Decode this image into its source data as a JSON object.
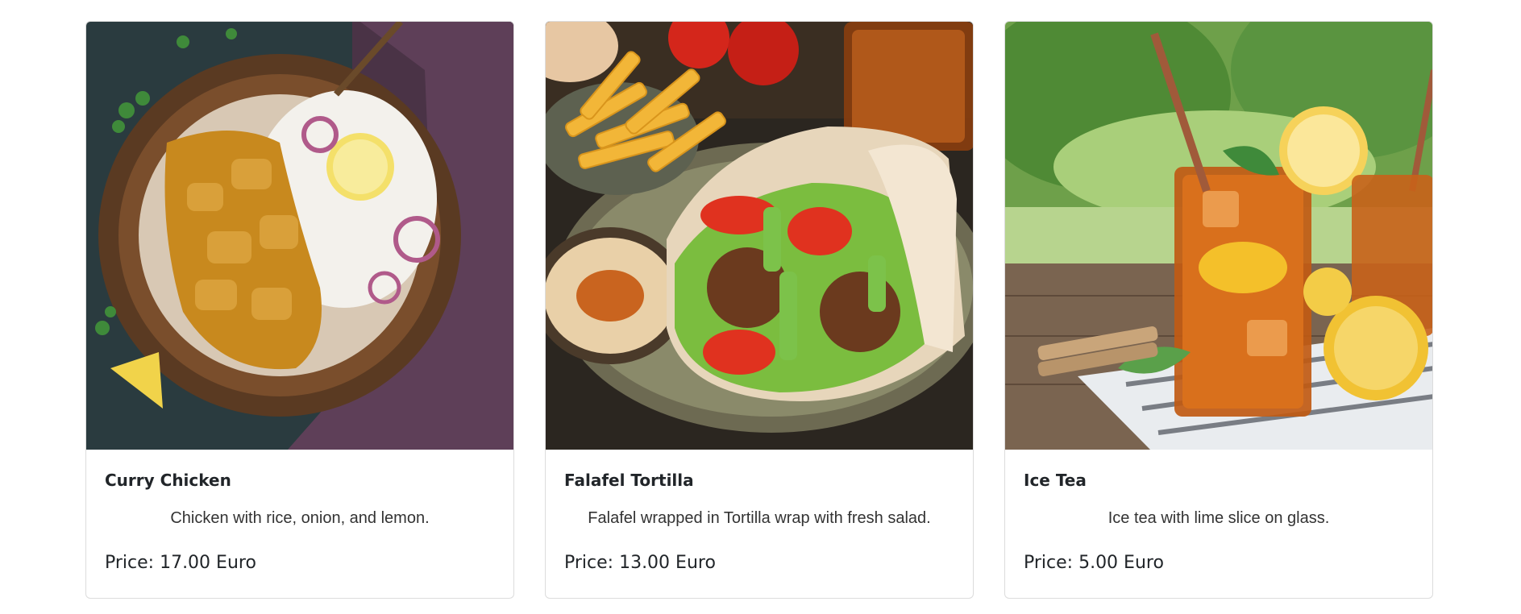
{
  "menu": {
    "items": [
      {
        "title": "Curry Chicken",
        "description": "Chicken with rice, onion, and lemon.",
        "price": "Price: 17.00 Euro",
        "image_alt": "curry-chicken-image"
      },
      {
        "title": "Falafel Tortilla",
        "description": "Falafel wrapped in Tortilla wrap with fresh salad.",
        "price": "Price: 13.00 Euro",
        "image_alt": "falafel-tortilla-image"
      },
      {
        "title": "Ice Tea",
        "description": "Ice tea with lime slice on glass.",
        "price": "Price: 5.00 Euro",
        "image_alt": "ice-tea-image"
      }
    ]
  },
  "colors": {
    "title_text": "#212529",
    "body_text": "#333333",
    "card_border": "#dcdcdc"
  }
}
